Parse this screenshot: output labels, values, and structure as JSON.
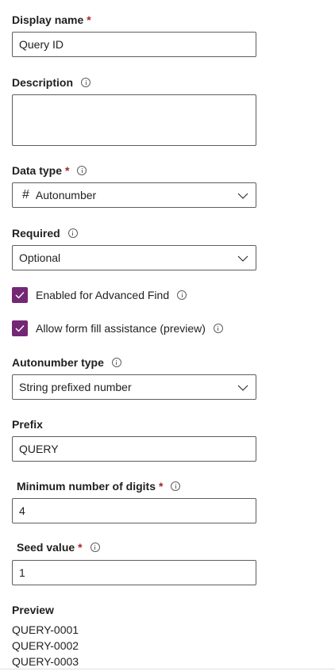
{
  "display_name": {
    "label": "Display name",
    "required_mark": "*",
    "value": "Query ID"
  },
  "description": {
    "label": "Description",
    "value": ""
  },
  "data_type": {
    "label": "Data type",
    "required_mark": "*",
    "icon_glyph": "#",
    "value": "Autonumber"
  },
  "required": {
    "label": "Required",
    "value": "Optional"
  },
  "advanced_find": {
    "label": "Enabled for Advanced Find",
    "checked": true
  },
  "form_fill": {
    "label": "Allow form fill assistance (preview)",
    "checked": true
  },
  "autonumber_type": {
    "label": "Autonumber type",
    "value": "String prefixed number"
  },
  "prefix": {
    "label": "Prefix",
    "value": "QUERY"
  },
  "min_digits": {
    "label": "Minimum number of digits",
    "required_mark": "*",
    "value": "4"
  },
  "seed_value": {
    "label": "Seed value",
    "required_mark": "*",
    "value": "1"
  },
  "preview": {
    "label": "Preview",
    "lines": [
      "QUERY-0001",
      "QUERY-0002",
      "QUERY-0003"
    ]
  },
  "colors": {
    "accent": "#742774",
    "required": "#a4262c",
    "border": "#605e5c"
  }
}
